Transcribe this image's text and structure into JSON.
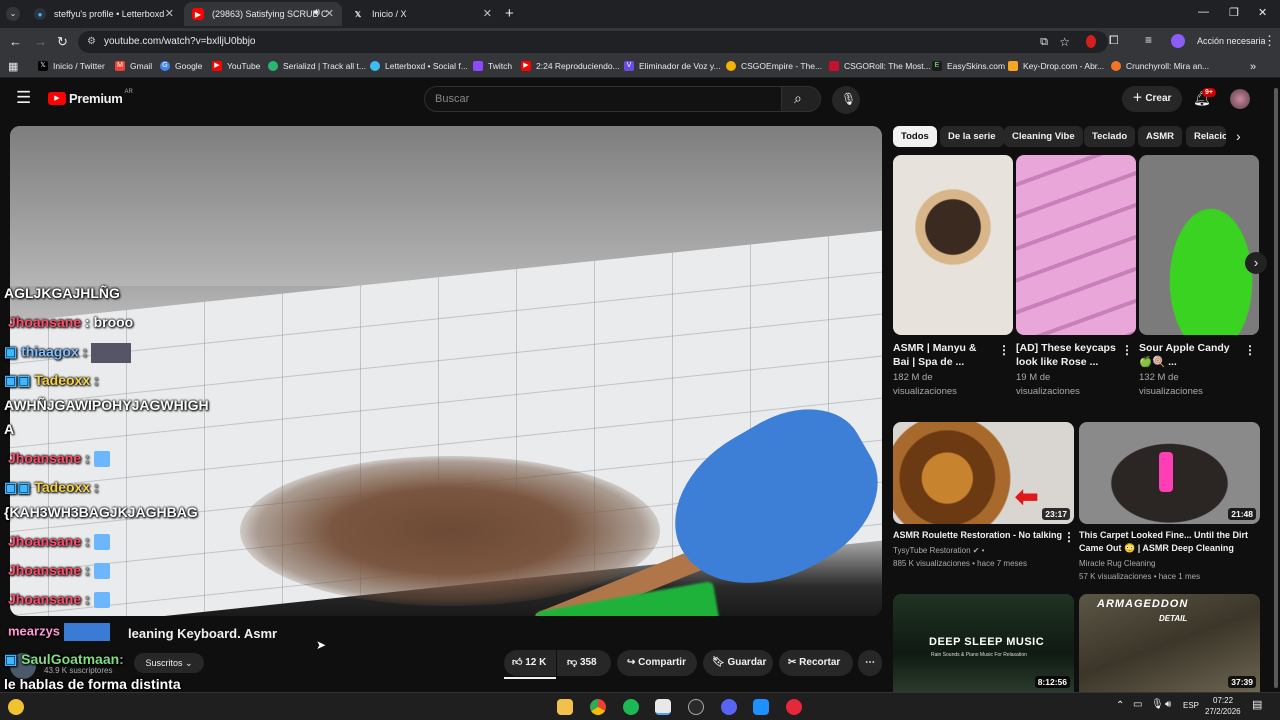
{
  "browser": {
    "tabs": [
      {
        "title": "steffyu's profile • Letterboxd",
        "active": false
      },
      {
        "title": "(29863) Satisfying SCRUB C",
        "active": true
      },
      {
        "title": "Inicio / X",
        "active": false
      }
    ],
    "url": "youtube.com/watch?v=bxlljU0bbjo",
    "profile_label": "Acción necesaria",
    "bookmarks": [
      "Inicio / Twitter",
      "Gmail",
      "Google",
      "YouTube",
      "Serializd | Track all t...",
      "Letterboxd • Social f...",
      "Twitch",
      "2:24 Reproduciendo...",
      "Eliminador de Voz y...",
      "CSGOEmpire - The...",
      "CSGORoll: The Most...",
      "EasySkins.com",
      "Key-Drop.com - Abr...",
      "Crunchyroll: Mira an..."
    ]
  },
  "youtube": {
    "logo": "Premium",
    "logo_region": "AR",
    "search_placeholder": "Buscar",
    "create_label": "Crear",
    "notif_count": "9+"
  },
  "chat": [
    {
      "text": "AGLJKGAJHLÑG"
    },
    {
      "user": "Jhoansane",
      "msg": ": brooo"
    },
    {
      "user": "thiaagox",
      "msg": ":"
    },
    {
      "user": "Tadeoxx",
      "msg": ":"
    },
    {
      "text": "AWHÑJGAWIPOHYJAGWHIGH"
    },
    {
      "text": "A"
    },
    {
      "user": "Jhoansane",
      "msg": ":"
    },
    {
      "user": "Tadeoxx",
      "msg": ":"
    },
    {
      "text": "{KAH3WH3BAGJKJAGHBAG"
    },
    {
      "user": "Jhoansane",
      "msg": ":"
    },
    {
      "user": "Jhoansane",
      "msg": ":"
    },
    {
      "user": "Jhoansane",
      "msg": ":"
    },
    {
      "user": "mearzys",
      "msg": ""
    },
    {
      "user": "SaulGoatmaan",
      "msg": ":"
    },
    {
      "text": "le hablas de forma distinta"
    }
  ],
  "video": {
    "title_partial": "leaning Keyboard. Asmr",
    "channel_subs": "43.9 K suscriptores",
    "subscribe_label": "Suscritos",
    "likes": "12 K",
    "dislikes": "358",
    "share_label": "Compartir",
    "save_label": "Guardar",
    "clip_label": "Recortar"
  },
  "chips": [
    "Todos",
    "De la serie",
    "Cleaning Vibe",
    "Teclado",
    "ASMR",
    "Relacio"
  ],
  "shorts": [
    {
      "title1": "ASMR | Manyu &",
      "title2": "Bai | Spa de ...",
      "views1": "182 M de",
      "views2": "visualizaciones"
    },
    {
      "title1": "[AD] These keycaps",
      "title2": "look like Rose ...",
      "views1": "19 M de",
      "views2": "visualizaciones"
    },
    {
      "title1": "Sour Apple Candy",
      "title2": "🍏🍭 ...",
      "views1": "132 M de",
      "views2": "visualizaciones"
    }
  ],
  "videos": [
    {
      "title": "ASMR Roulette Restoration - No talking",
      "channel": "TysyTube Restoration",
      "meta": "885 K visualizaciones • hace 7 meses",
      "duration": "23:17"
    },
    {
      "title1": "This Carpet Looked Fine... Until the Dirt",
      "title2": "Came Out 😳 | ASMR Deep Cleaning",
      "channel": "Miracle Rug Cleaning",
      "meta": "57 K visualizaciones • hace 1 mes",
      "duration": "21:48"
    },
    {
      "overlay": "DEEP SLEEP MUSIC",
      "overlay_sub": "Rain Sounds & Piano Music For Relaxation",
      "duration": "8:12:56"
    },
    {
      "overlay": "ARMAGEDDON",
      "overlay_sub": "DETAIL",
      "duration": "37:39"
    }
  ],
  "taskbar": {
    "lang": "ESP",
    "time": "07:22",
    "date": "27/2/2026"
  },
  "colors": {
    "yt_red": "#ff0000",
    "chat_red": "#ff4d6d",
    "chat_yellow": "#f7d44a"
  }
}
